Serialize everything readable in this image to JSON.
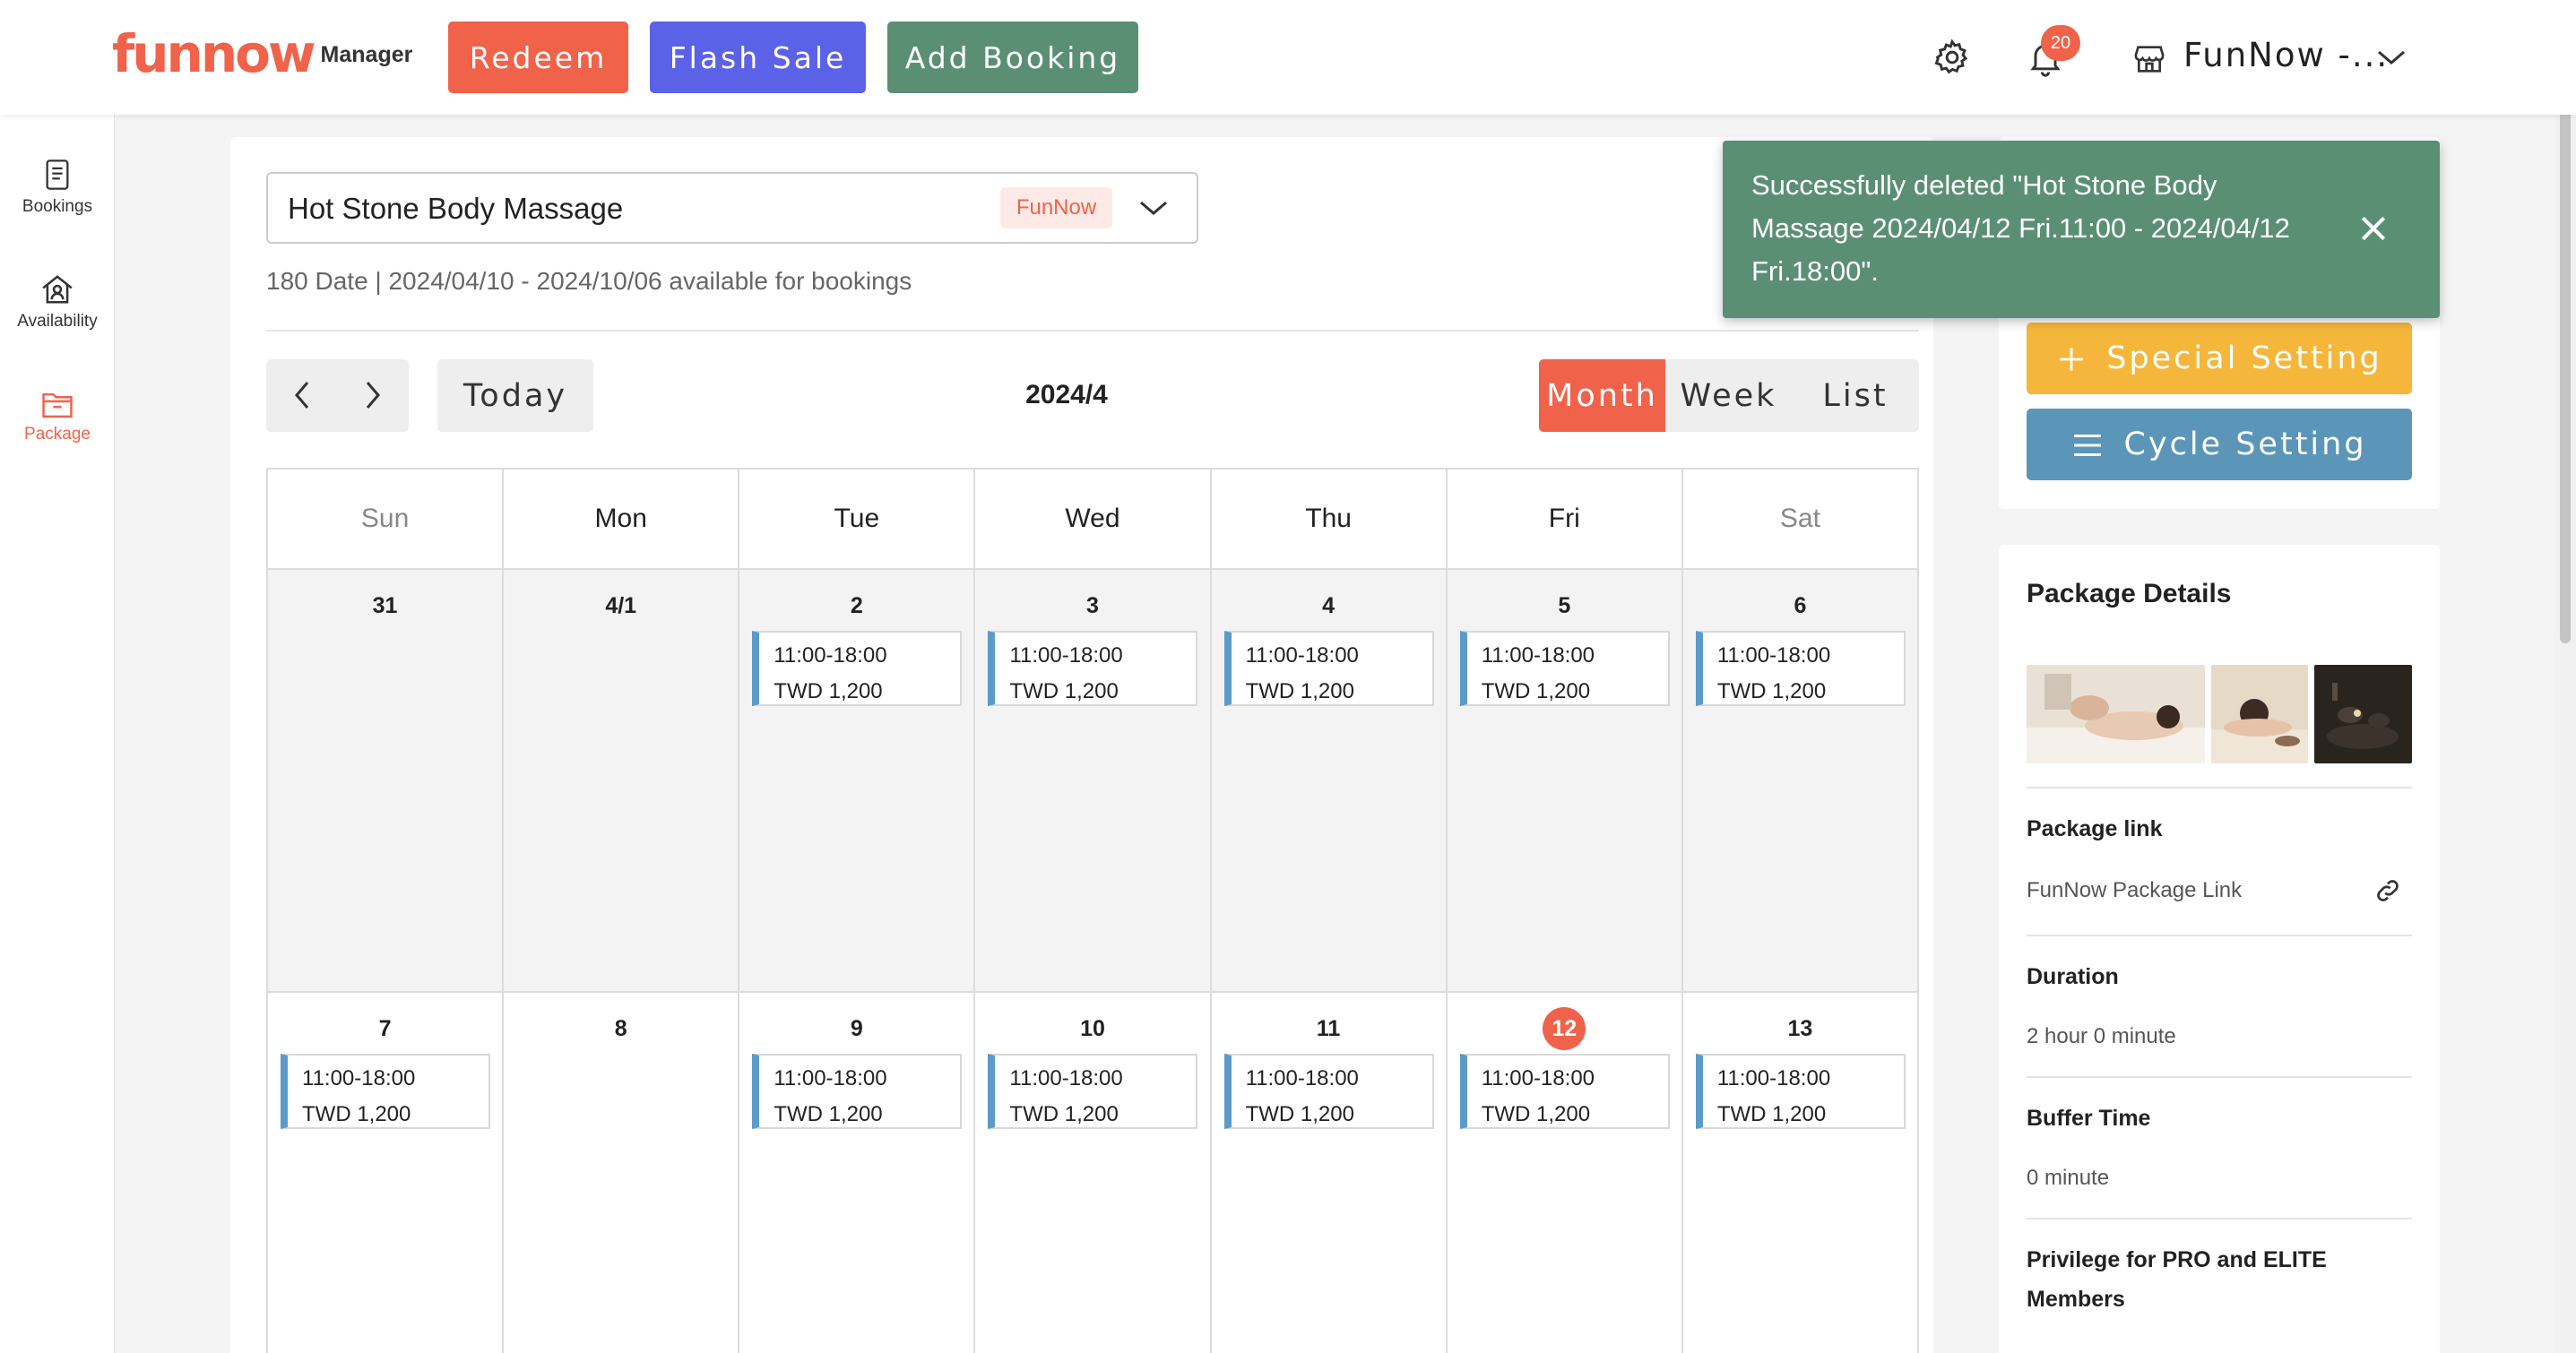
{
  "header": {
    "logo_text": "funnow",
    "logo_sub": "Manager",
    "buttons": {
      "redeem": "Redeem",
      "flash_sale": "Flash Sale",
      "add_booking": "Add Booking"
    },
    "notification_badge": "20",
    "store_name": "FunNow -..."
  },
  "sidebar": {
    "items": [
      {
        "label": "Bookings",
        "icon": "document-icon"
      },
      {
        "label": "Availability",
        "icon": "person-home-icon"
      },
      {
        "label": "Package",
        "icon": "folder-icon",
        "active": true
      }
    ]
  },
  "package": {
    "name": "Hot Stone Body Massage",
    "tag": "FunNow",
    "availability": "180 Date | 2024/04/10 - 2024/10/06 available for bookings"
  },
  "calendar": {
    "today_label": "Today",
    "title": "2024/4",
    "views": [
      "Month",
      "Week",
      "List"
    ],
    "active_view": "Month",
    "weekdays": [
      "Sun",
      "Mon",
      "Tue",
      "Wed",
      "Thu",
      "Fri",
      "Sat"
    ],
    "weeks": [
      [
        {
          "day": "31",
          "slot": null
        },
        {
          "day": "4/1",
          "slot": null
        },
        {
          "day": "2",
          "slot": {
            "time": "11:00-18:00",
            "price": "TWD 1,200"
          }
        },
        {
          "day": "3",
          "slot": {
            "time": "11:00-18:00",
            "price": "TWD 1,200"
          }
        },
        {
          "day": "4",
          "slot": {
            "time": "11:00-18:00",
            "price": "TWD 1,200"
          }
        },
        {
          "day": "5",
          "slot": {
            "time": "11:00-18:00",
            "price": "TWD 1,200"
          }
        },
        {
          "day": "6",
          "slot": {
            "time": "11:00-18:00",
            "price": "TWD 1,200"
          }
        }
      ],
      [
        {
          "day": "7",
          "slot": {
            "time": "11:00-18:00",
            "price": "TWD 1,200"
          }
        },
        {
          "day": "8",
          "slot": null
        },
        {
          "day": "9",
          "slot": {
            "time": "11:00-18:00",
            "price": "TWD 1,200"
          }
        },
        {
          "day": "10",
          "slot": {
            "time": "11:00-18:00",
            "price": "TWD 1,200"
          }
        },
        {
          "day": "11",
          "slot": {
            "time": "11:00-18:00",
            "price": "TWD 1,200"
          }
        },
        {
          "day": "12",
          "slot": {
            "time": "11:00-18:00",
            "price": "TWD 1,200"
          },
          "today": true
        },
        {
          "day": "13",
          "slot": {
            "time": "11:00-18:00",
            "price": "TWD 1,200"
          }
        }
      ]
    ]
  },
  "side": {
    "special_setting": "Special Setting",
    "cycle_setting": "Cycle Setting",
    "details_title": "Package Details",
    "package_link_label": "Package link",
    "package_link_text": "FunNow Package Link",
    "duration_label": "Duration",
    "duration_value": "2 hour 0 minute",
    "buffer_label": "Buffer Time",
    "buffer_value": "0 minute",
    "privilege_label": "Privilege for PRO and ELITE Members"
  },
  "toast": {
    "message": "Successfully deleted \"Hot Stone Body Massage 2024/04/12 Fri.11:00 - 2024/04/12 Fri.18:00\"."
  },
  "colors": {
    "brand": "#f0624a",
    "flash": "#5b62e8",
    "green": "#5b8f74",
    "special": "#f4b73c",
    "cycle": "#5b96b8",
    "slot_accent": "#5b9ac9"
  }
}
